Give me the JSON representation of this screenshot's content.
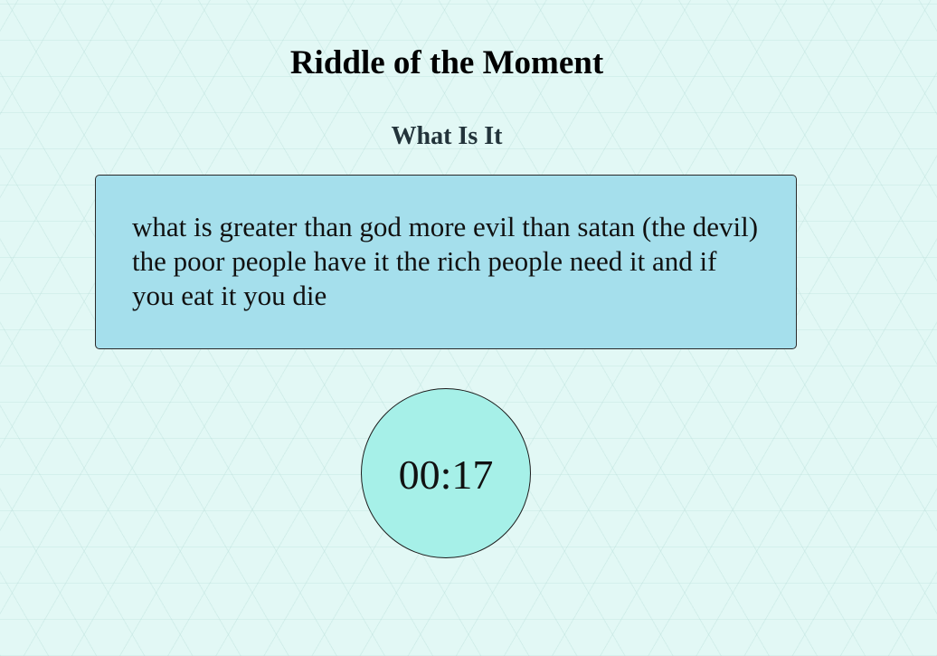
{
  "header": {
    "title": "Riddle of the Moment"
  },
  "riddle": {
    "title": "What Is It",
    "text": "what is greater than god more evil than satan (the devil) the poor people have it the rich people need it and if you eat it you die"
  },
  "timer": {
    "value": "00:17"
  },
  "colors": {
    "background": "#e2f8f5",
    "riddle_box": "#a5dfec",
    "timer_circle": "#a6f0e8"
  }
}
